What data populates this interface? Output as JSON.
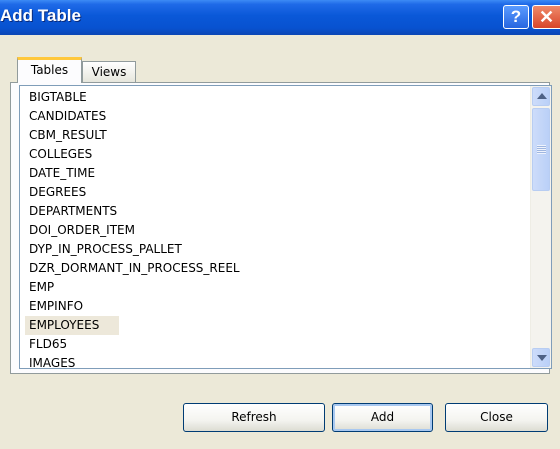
{
  "window": {
    "title": "Add Table",
    "help_label": "?",
    "close_label": "✕"
  },
  "tabs": [
    {
      "label": "Tables",
      "selected": true
    },
    {
      "label": "Views",
      "selected": false
    }
  ],
  "table_list": {
    "items": [
      "BIGTABLE",
      "CANDIDATES",
      "CBM_RESULT",
      "COLLEGES",
      "DATE_TIME",
      "DEGREES",
      "DEPARTMENTS",
      "DOI_ORDER_ITEM",
      "DYP_IN_PROCESS_PALLET",
      "DZR_DORMANT_IN_PROCESS_REEL",
      "EMP",
      "EMPINFO",
      "EMPLOYEES",
      "FLD65",
      "IMAGES"
    ],
    "selected": "EMPLOYEES"
  },
  "buttons": {
    "refresh": "Refresh",
    "add": "Add",
    "close": "Close"
  },
  "colors": {
    "titlebar": "#0a58d8",
    "tab_highlight": "#ffc83c",
    "selection": "#ede8da"
  },
  "icons": {
    "scroll_up": "chevron-up-icon",
    "scroll_down": "chevron-down-icon"
  }
}
